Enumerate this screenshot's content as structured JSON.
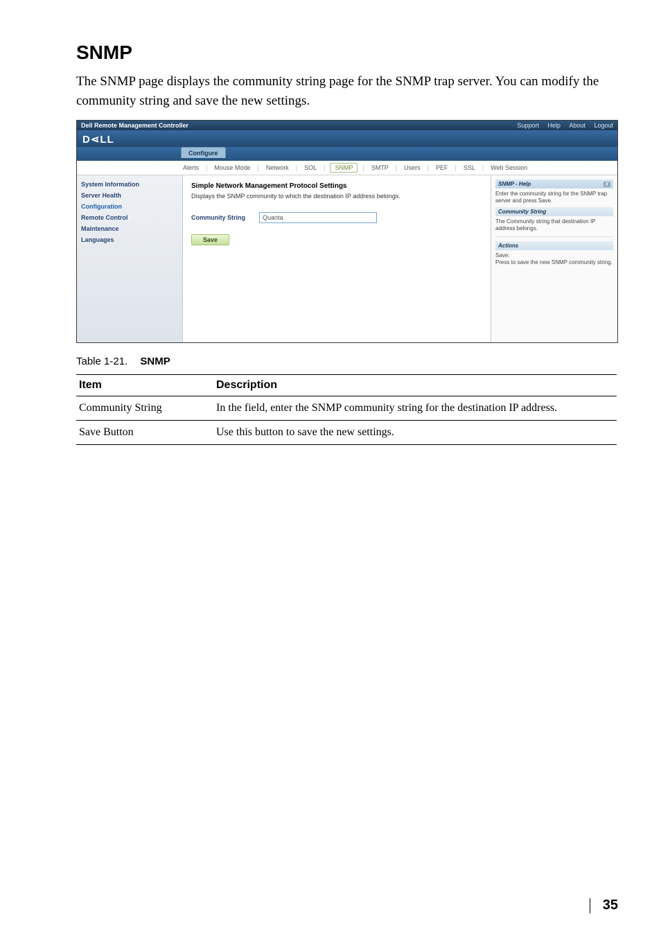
{
  "page": {
    "heading": "SNMP",
    "intro": "The SNMP page displays the community string page for the SNMP trap server. You can modify the community string and save the new settings.",
    "number": "35"
  },
  "bmc": {
    "titlebar": "Dell Remote Management Controller",
    "toplinks": {
      "support": "Support",
      "help": "Help",
      "about": "About",
      "logout": "Logout"
    },
    "config_tab": "Configure",
    "subtabs": {
      "alerts": "Alerts",
      "mouse": "Mouse Mode",
      "network": "Network",
      "sol": "SOL",
      "snmp": "SNMP",
      "smtp": "SMTP",
      "users": "Users",
      "pef": "PEF",
      "ssl": "SSL",
      "web": "Web Session"
    },
    "sidebar": {
      "sysinfo": "System Information",
      "health": "Server Health",
      "config": "Configuration",
      "remote": "Remote Control",
      "maint": "Maintenance",
      "lang": "Languages"
    },
    "main": {
      "title": "Simple Network Management Protocol Settings",
      "desc": "Displays the SNMP community to which the destination IP address belongs.",
      "field_label": "Community String",
      "field_value": "Quanta",
      "save": "Save"
    },
    "help": {
      "title": "SNMP - Help",
      "p1": "Enter the community string for the SNMP trap server and press Save.",
      "h2": "Community String",
      "p2": "The Community string that destination IP address belongs.",
      "h3": "Actions",
      "p3a": "Save:",
      "p3b": "Press to save the new SNMP community string."
    }
  },
  "table": {
    "caption_number": "Table 1-21.",
    "caption_name": "SNMP",
    "header_item": "Item",
    "header_desc": "Description",
    "rows": [
      {
        "item": "Community String",
        "desc": "In the field, enter the SNMP community string for the destination IP address."
      },
      {
        "item": "Save Button",
        "desc": "Use this button to save the new settings."
      }
    ]
  }
}
